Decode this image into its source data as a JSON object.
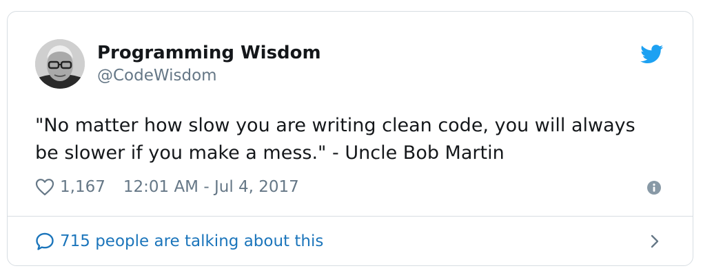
{
  "author": {
    "name": "Programming Wisdom",
    "handle": "@CodeWisdom",
    "avatar": "avatar"
  },
  "tweet": {
    "text": "\"No matter how slow you are writing clean code, you will always be slower if you make a mess.\" - Uncle Bob Martin",
    "like_count": "1,167",
    "timestamp": "12:01 AM - Jul 4, 2017"
  },
  "conversation": {
    "label": "715 people are talking about this"
  },
  "icons": {
    "brand": "twitter-bird-icon",
    "like": "heart-icon",
    "info": "info-icon",
    "reply": "speech-bubble-icon",
    "more": "chevron-right-icon"
  },
  "colors": {
    "brand_blue": "#1da1f2",
    "link_blue": "#1b75bb",
    "secondary_text": "#657786",
    "border": "#d7dde2"
  }
}
